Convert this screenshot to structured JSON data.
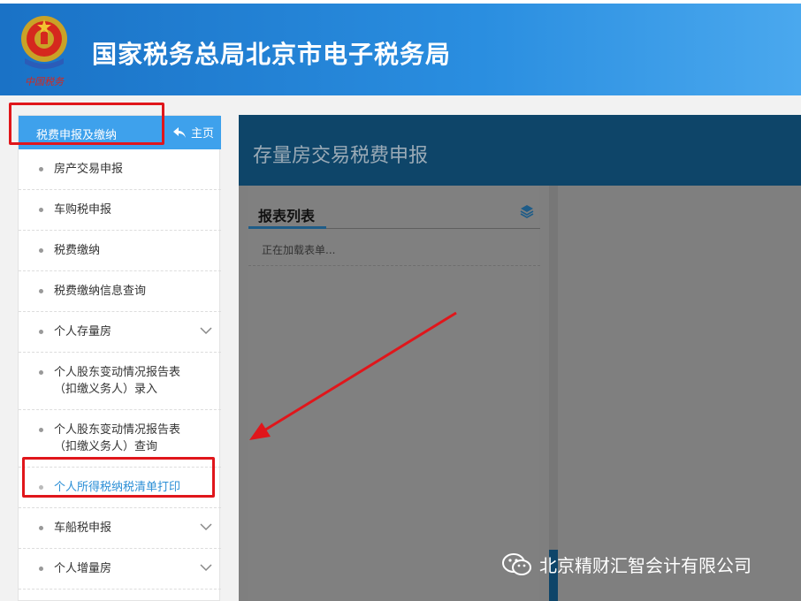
{
  "header": {
    "title": "国家税务总局北京市电子税务局",
    "emblem_caption": "中国税务"
  },
  "sidebar": {
    "title": "税费申报及缴纳",
    "home_label": "主页",
    "items": [
      {
        "label": "房产交易申报",
        "expandable": false
      },
      {
        "label": "车购税申报",
        "expandable": false
      },
      {
        "label": "税费缴纳",
        "expandable": false
      },
      {
        "label": "税费缴纳信息查询",
        "expandable": false
      },
      {
        "label": "个人存量房",
        "expandable": true
      },
      {
        "label": "个人股东变动情况报告表（扣缴义务人）录入",
        "expandable": false
      },
      {
        "label": "个人股东变动情况报告表（扣缴义务人）查询",
        "expandable": false
      },
      {
        "label": "个人所得税纳税清单打印",
        "expandable": false,
        "active": true
      },
      {
        "label": "车船税申报",
        "expandable": true
      },
      {
        "label": "个人增量房",
        "expandable": true
      }
    ]
  },
  "main": {
    "page_title": "存量房交易税费申报",
    "panel_title": "报表列表",
    "loading_text": "正在加载表单..."
  },
  "watermark": {
    "text": "北京精财汇智会计有限公司"
  },
  "colors": {
    "header_blue": "#1a72c6",
    "sidebar_head": "#3ea1ec",
    "active_link": "#2c8fd6",
    "highlight_red": "#e0161b",
    "main_header": "#0e4569"
  }
}
